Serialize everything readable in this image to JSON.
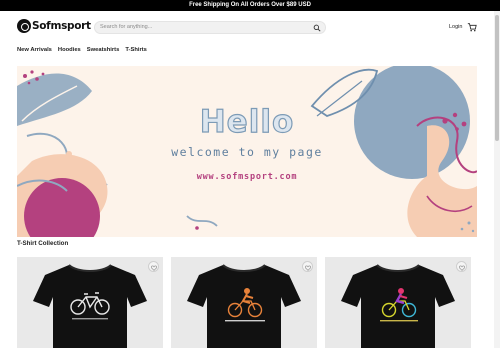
{
  "announcement": "Free Shipping On All Orders Over $89 USD",
  "brand": {
    "name": "Sofmsport"
  },
  "search": {
    "placeholder": "Search for anything..."
  },
  "header": {
    "login_label": "Login"
  },
  "nav": {
    "items": [
      "New Arrivals",
      "Hoodies",
      "Sweatshirts",
      "T-Shirts"
    ]
  },
  "banner": {
    "title": "Hello",
    "subtitle": "welcome to my page",
    "url": "www.sofmsport.com"
  },
  "section": {
    "title": "T-Shirt Collection"
  },
  "products": [
    {
      "design": "bicycle-print",
      "color": "#111111"
    },
    {
      "design": "cyclist-orange-print",
      "color": "#111111"
    },
    {
      "design": "cyclist-colorful-print",
      "color": "#111111"
    }
  ],
  "colors": {
    "accent": "#b4417f",
    "banner_bg": "#fdf3ea",
    "blob_blue": "#8fa8c0",
    "blob_magenta": "#b4417f"
  }
}
